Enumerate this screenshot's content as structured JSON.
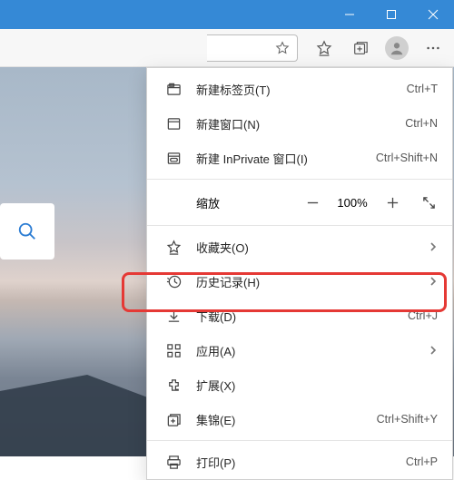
{
  "window": {
    "minimize": "—",
    "maximize": "▢",
    "close": "✕"
  },
  "menu": {
    "new_tab": {
      "label": "新建标签页(T)",
      "accel": "Ctrl+T"
    },
    "new_window": {
      "label": "新建窗口(N)",
      "accel": "Ctrl+N"
    },
    "new_inprivate": {
      "label": "新建 InPrivate 窗口(I)",
      "accel": "Ctrl+Shift+N"
    },
    "zoom": {
      "label": "缩放",
      "value": "100%"
    },
    "favorites": {
      "label": "收藏夹(O)"
    },
    "history": {
      "label": "历史记录(H)"
    },
    "downloads": {
      "label": "下载(D)",
      "accel": "Ctrl+J"
    },
    "apps": {
      "label": "应用(A)"
    },
    "extensions": {
      "label": "扩展(X)"
    },
    "collections": {
      "label": "集锦(E)",
      "accel": "Ctrl+Shift+Y"
    },
    "print": {
      "label": "打印(P)",
      "accel": "Ctrl+P"
    }
  }
}
